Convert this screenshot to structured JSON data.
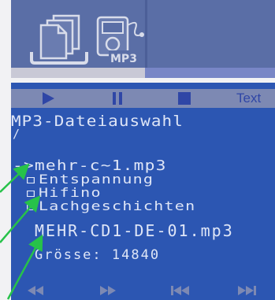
{
  "toolbar": {
    "text_label": "Text"
  },
  "screen": {
    "title": "MP3-Dateiauswahl",
    "path": "/",
    "selected_item": "->mehr-c~1.mp3",
    "sub_items": [
      "Entspannung",
      "Hifino",
      "Lachgeschichten"
    ],
    "file_name": "MEHR-CD1-DE-01.mp3",
    "size_line": "Grösse: 14840"
  },
  "mp3_badge": "MP3",
  "colors": {
    "screen_bg": "#2c56b2",
    "toolbar_bg": "#7d89b3",
    "lcd_text": "#dfe6f7",
    "annotation_arrow": "#27c24a"
  }
}
